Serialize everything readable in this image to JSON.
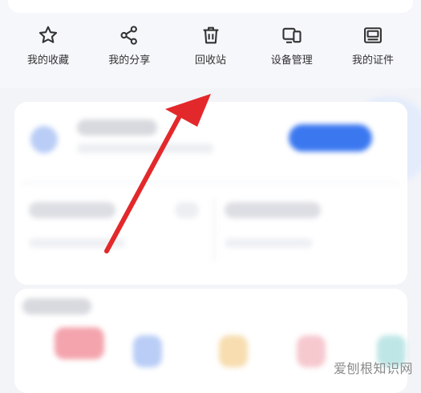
{
  "quick_actions": [
    {
      "label": "我的收藏",
      "icon": "star-icon"
    },
    {
      "label": "我的分享",
      "icon": "share-icon"
    },
    {
      "label": "回收站",
      "icon": "trash-icon"
    },
    {
      "label": "设备管理",
      "icon": "devices-icon"
    },
    {
      "label": "我的证件",
      "icon": "id-card-icon"
    }
  ],
  "colors": {
    "arrow": "#e3282b",
    "accent": "#3b78f0",
    "icon": "#333333"
  },
  "watermark": "爱刨根知识网"
}
